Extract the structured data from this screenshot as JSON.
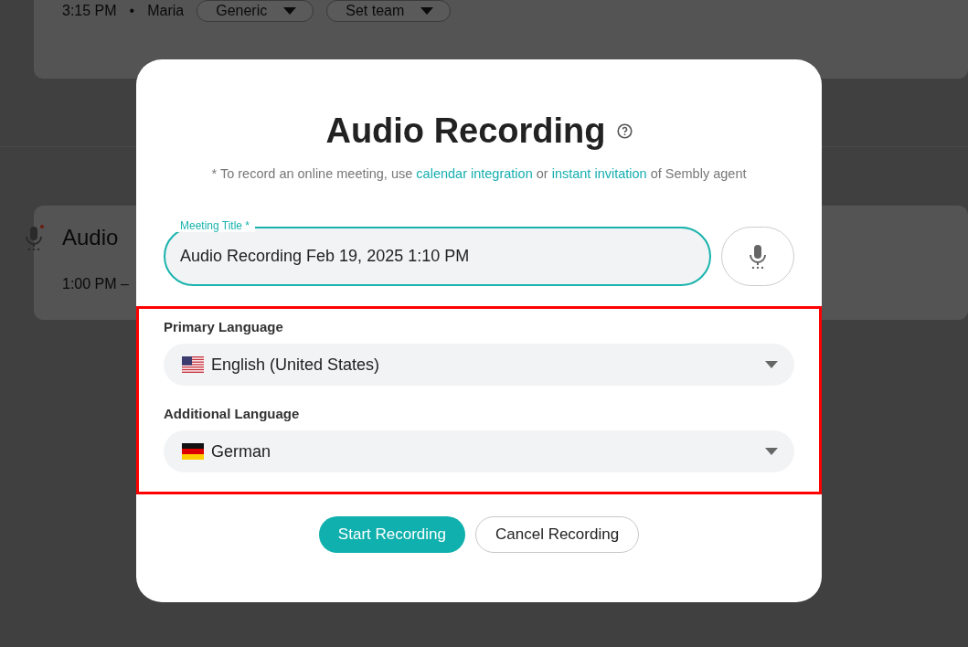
{
  "background": {
    "card_1": {
      "time": "3:15 PM",
      "separator": "•",
      "owner": "Maria",
      "dropdowns": [
        "Generic",
        "Set team"
      ]
    },
    "card_2": {
      "title": "Audio",
      "time": "1:00 PM –"
    }
  },
  "dialog": {
    "title": "Audio Recording",
    "note": [
      {
        "kind": "text",
        "text": "* To record an online meeting, use "
      },
      {
        "kind": "link",
        "text": "calendar integration"
      },
      {
        "kind": "text",
        "text": " or "
      },
      {
        "kind": "link",
        "text": "instant invitation"
      },
      {
        "kind": "text",
        "text": " of Sembly agent"
      }
    ],
    "meeting_title": {
      "label": "Meeting Title *",
      "value": "Audio Recording Feb 19, 2025 1:10 PM",
      "focused": true
    },
    "language_section": {
      "highlighted": true,
      "fields": [
        {
          "label": "Primary Language",
          "value": "English (United States)",
          "kind": "us"
        },
        {
          "label": "Additional Language",
          "value": "German",
          "kind": "de"
        }
      ]
    },
    "buttons": [
      {
        "label": "Start Recording",
        "kind": "primary"
      },
      {
        "label": "Cancel Recording",
        "kind": "secondary"
      }
    ]
  }
}
